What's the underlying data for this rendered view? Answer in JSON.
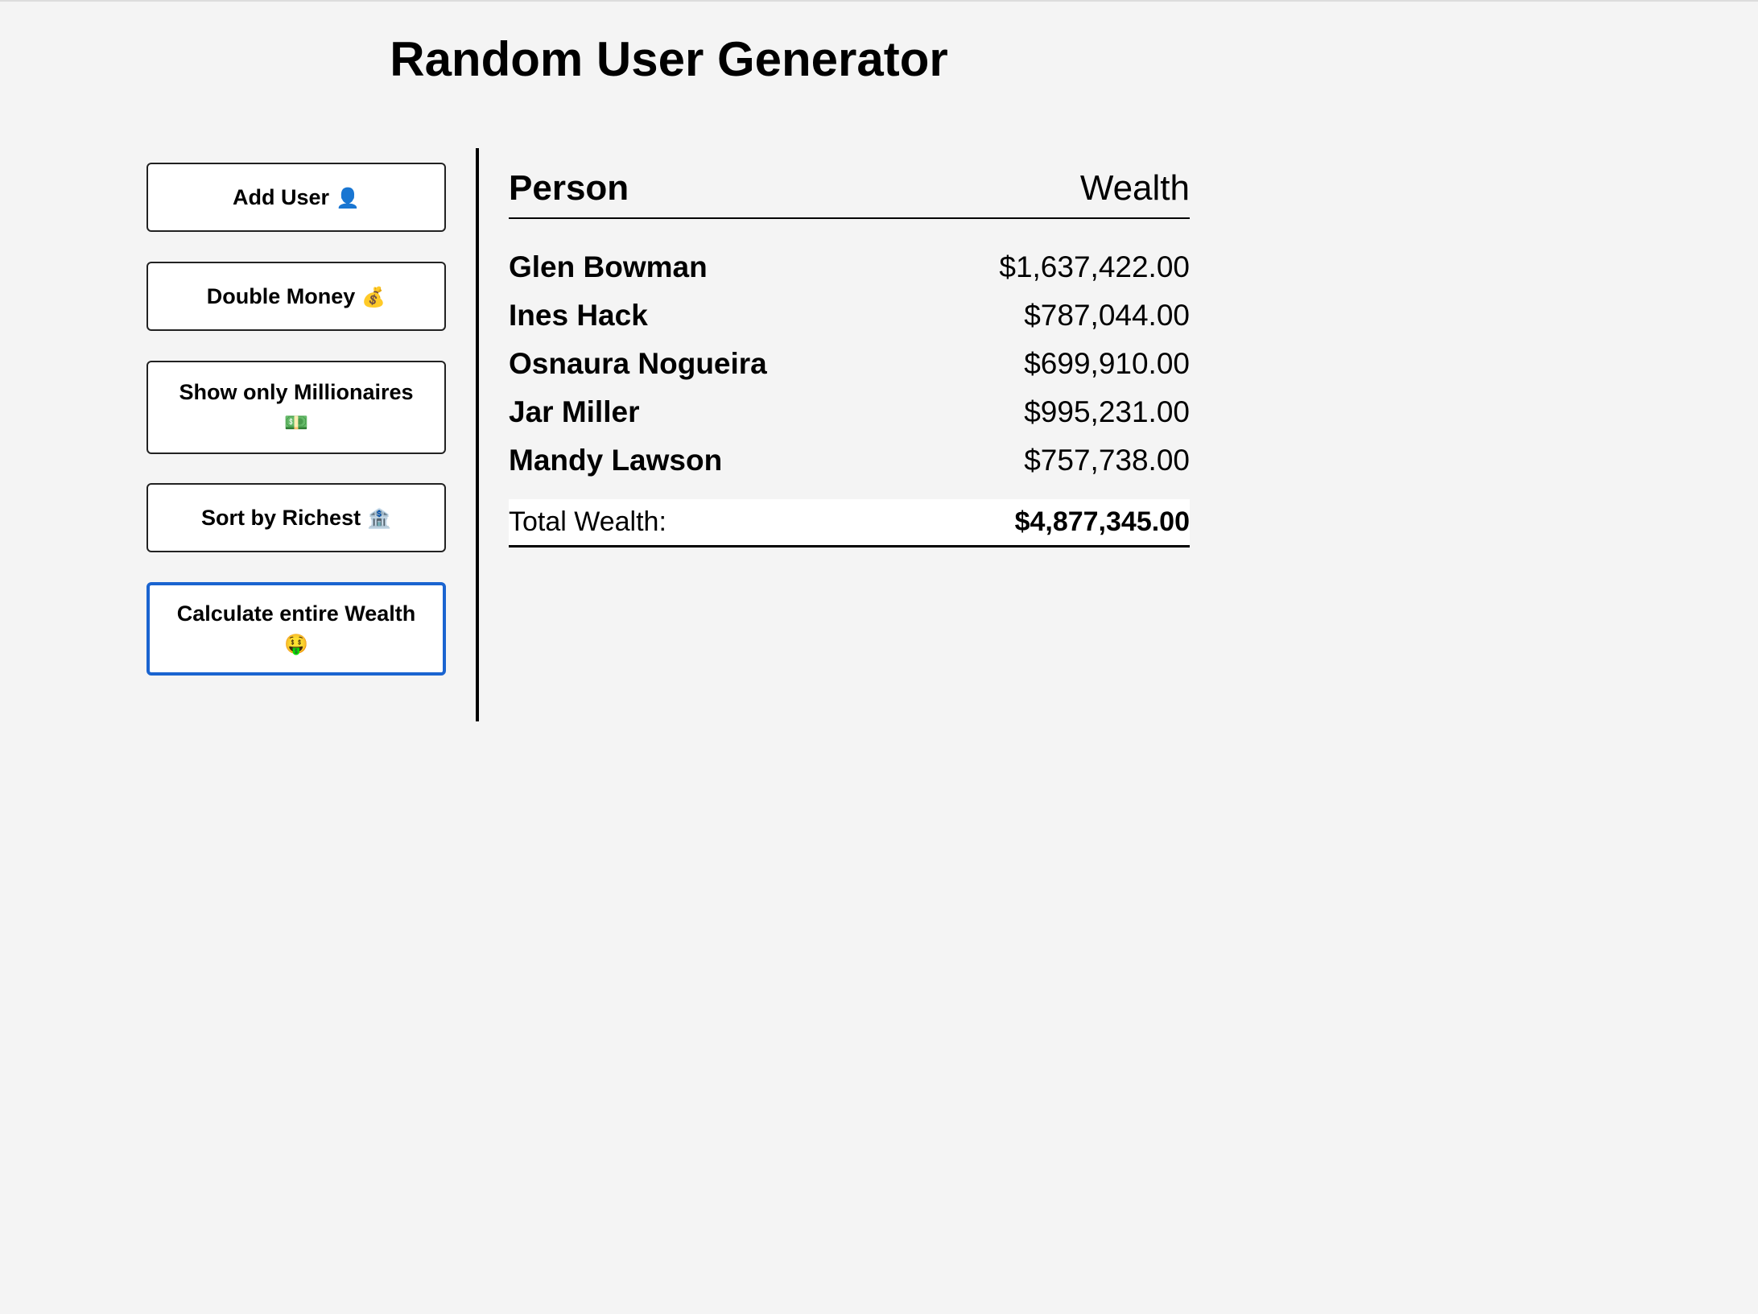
{
  "header": {
    "title": "Random User Generator"
  },
  "sidebar": {
    "buttons": [
      {
        "label": "Add User",
        "emoji": "👤",
        "icon": "bust-silhouette-icon"
      },
      {
        "label": "Double Money",
        "emoji": "💰",
        "icon": "money-bag-icon"
      },
      {
        "label": "Show only Millionaires",
        "emoji": "💵",
        "icon": "dollar-banknote-icon"
      },
      {
        "label": "Sort by Richest",
        "emoji": "🏦",
        "icon": "bank-icon"
      },
      {
        "label": "Calculate entire Wealth",
        "emoji": "🤑",
        "icon": "money-mouth-face-icon"
      }
    ],
    "active_button": "Calculate entire Wealth",
    "active_color": "#1a64d0"
  },
  "main": {
    "columns": {
      "person": "Person",
      "wealth": "Wealth"
    },
    "rows": [
      {
        "name": "Glen Bowman",
        "wealth": "$1,637,422.00"
      },
      {
        "name": "Ines Hack",
        "wealth": "$787,044.00"
      },
      {
        "name": "Osnaura Nogueira",
        "wealth": "$699,910.00"
      },
      {
        "name": "Jar Miller",
        "wealth": "$995,231.00"
      },
      {
        "name": "Mandy Lawson",
        "wealth": "$757,738.00"
      }
    ],
    "total": {
      "label": "Total Wealth:",
      "value": "$4,877,345.00"
    }
  }
}
